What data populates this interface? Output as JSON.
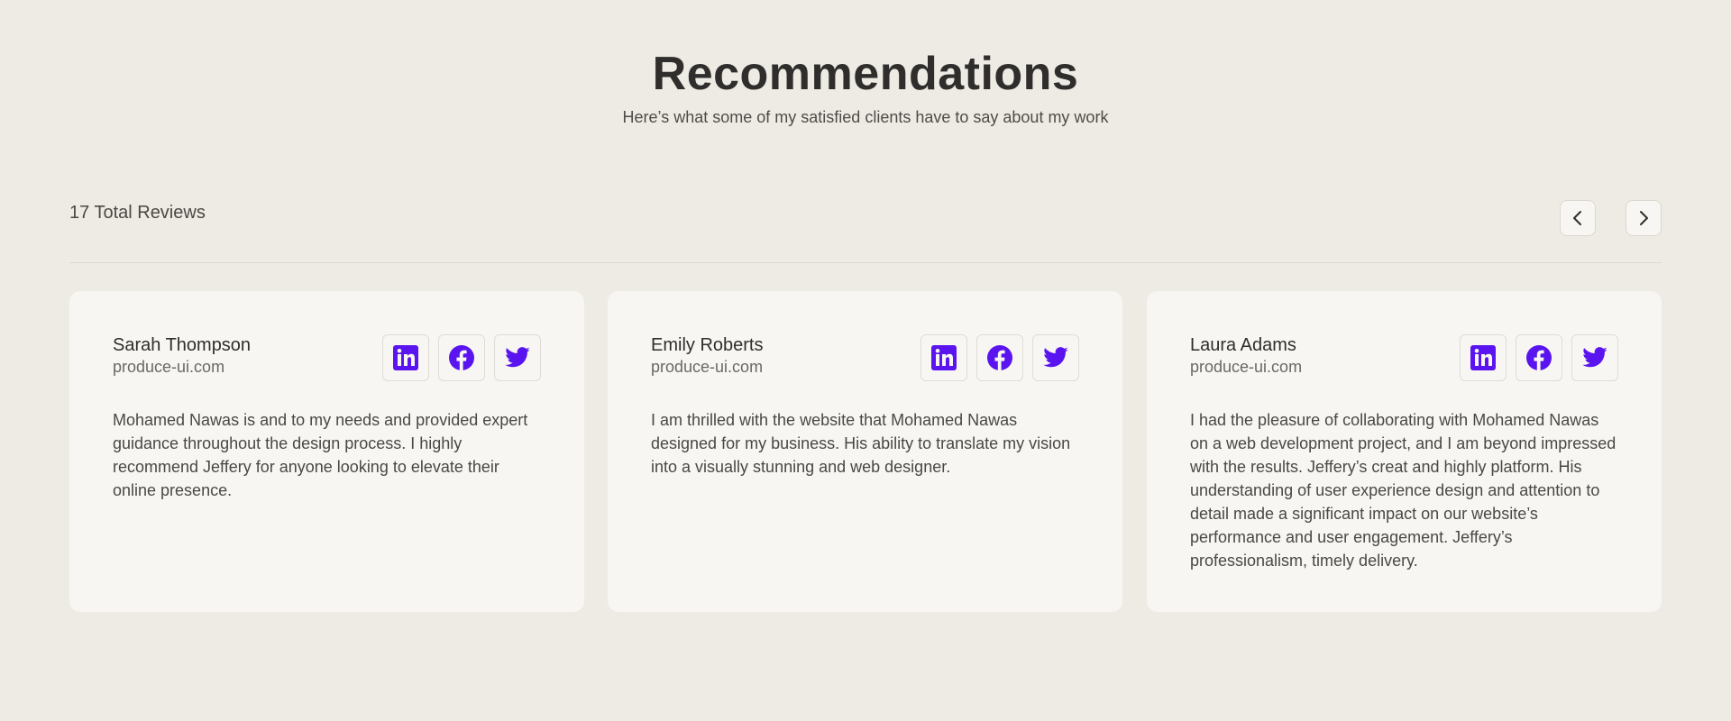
{
  "header": {
    "title": "Recommendations",
    "subtitle": "Here’s what some of my satisfied clients have to say about my work"
  },
  "reviews_bar": {
    "total_label": "17 Total Reviews",
    "prev_icon": "chevron-left-icon",
    "next_icon": "chevron-right-icon"
  },
  "colors": {
    "background": "#eeebe4",
    "card": "#f7f6f3",
    "accent": "#5a14f0",
    "text": "#2f2e2c"
  },
  "reviews": [
    {
      "name": "Sarah Thompson",
      "site": "produce-ui.com",
      "socials": [
        "linkedin-icon",
        "facebook-icon",
        "twitter-icon"
      ],
      "text": "Mohamed Nawas is and to my needs and provided expert guidance throughout the design process. I highly recommend Jeffery for anyone looking to elevate their online presence."
    },
    {
      "name": "Emily Roberts",
      "site": "produce-ui.com",
      "socials": [
        "linkedin-icon",
        "facebook-icon",
        "twitter-icon"
      ],
      "text": "I am thrilled with the website that Mohamed Nawas designed for my business. His ability to translate my vision into a visually stunning and web designer."
    },
    {
      "name": "Laura Adams",
      "site": "produce-ui.com",
      "socials": [
        "linkedin-icon",
        "facebook-icon",
        "twitter-icon"
      ],
      "text": "I had the pleasure of collaborating with Mohamed Nawas on a web development project, and I am beyond impressed with the results. Jeffery’s creat and highly platform. His understanding of user experience design and attention to detail made a significant impact on our website’s performance and user engagement. Jeffery’s professionalism, timely delivery."
    }
  ]
}
